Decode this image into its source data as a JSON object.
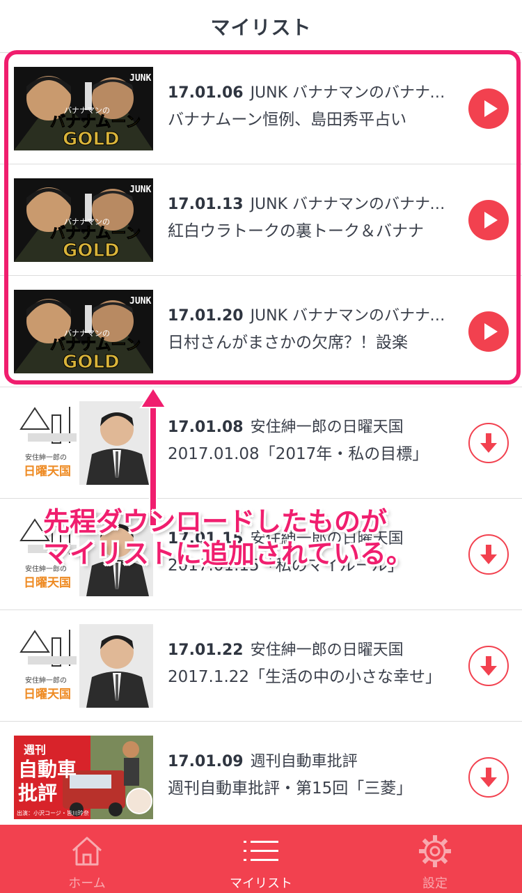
{
  "header": {
    "title": "マイリスト"
  },
  "items": [
    {
      "date": "17.01.06",
      "program": "JUNK バナナマンのバナナムーンGOLD",
      "episode": "バナナムーン恒例、島田秀平占い",
      "action": "play",
      "thumb": "bananaman"
    },
    {
      "date": "17.01.13",
      "program": "JUNK バナナマンのバナナムーンGOLD",
      "episode": "紅白ウラトークの裏トーク＆バナナ",
      "action": "play",
      "thumb": "bananaman"
    },
    {
      "date": "17.01.20",
      "program": "JUNK バナナマンのバナナムーンGOLD",
      "episode": "日村さんがまさかの欠席？！設楽",
      "action": "play",
      "thumb": "bananaman"
    },
    {
      "date": "17.01.08",
      "program": "安住紳一郎の日曜天国",
      "episode": "2017.01.08「2017年・私の目標」",
      "action": "download",
      "thumb": "azumi"
    },
    {
      "date": "17.01.15",
      "program": "安住紳一郎の日曜天国",
      "episode": "2017.01.15「私のマイルール」",
      "action": "download",
      "thumb": "azumi"
    },
    {
      "date": "17.01.22",
      "program": "安住紳一郎の日曜天国",
      "episode": "2017.1.22「生活の中の小さな幸せ」",
      "action": "download",
      "thumb": "azumi"
    },
    {
      "date": "17.01.09",
      "program": "週刊自動車批評",
      "episode": "週刊自動車批評・第15回「三菱」",
      "action": "download",
      "thumb": "jidosha"
    }
  ],
  "thumbs": {
    "bananaman_logo": "バナナムーン",
    "bananaman_gold": "GOLD",
    "bananaman_small": "バナナマンの",
    "junk": "JUNK",
    "azumi_small": "安住紳一郎の",
    "azumi_title": "日曜天国",
    "jidosha_top": "週刊",
    "jidosha_mid": "自動車",
    "jidosha_bot": "批評",
    "jidosha_cast": "出演：小沢コージ・皆川玲奈"
  },
  "annotation": {
    "line1": "先程ダウンロードしたものが",
    "line2": "マイリストに追加されている。",
    "color": "#f01e6e"
  },
  "tabbar": {
    "tabs": [
      {
        "label": "ホーム",
        "icon": "home-icon",
        "active": false
      },
      {
        "label": "マイリスト",
        "icon": "list-icon",
        "active": true
      },
      {
        "label": "設定",
        "icon": "gear-icon",
        "active": false
      }
    ],
    "color": "#f2414f"
  }
}
